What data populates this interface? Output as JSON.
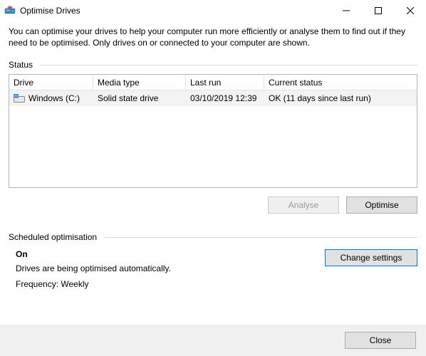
{
  "window": {
    "title": "Optimise Drives"
  },
  "intro": "You can optimise your drives to help your computer run more efficiently or analyse them to find out if they need to be optimised. Only drives on or connected to your computer are shown.",
  "status_label": "Status",
  "table": {
    "headers": {
      "drive": "Drive",
      "media": "Media type",
      "last": "Last run",
      "status": "Current status"
    },
    "rows": [
      {
        "drive": "Windows (C:)",
        "media": "Solid state drive",
        "last": "03/10/2019 12:39",
        "status": "OK (11 days since last run)"
      }
    ]
  },
  "buttons": {
    "analyse": "Analyse",
    "optimise": "Optimise",
    "change_settings": "Change settings",
    "close": "Close"
  },
  "scheduled": {
    "label": "Scheduled optimisation",
    "state": "On",
    "desc": "Drives are being optimised automatically.",
    "frequency": "Frequency: Weekly"
  }
}
